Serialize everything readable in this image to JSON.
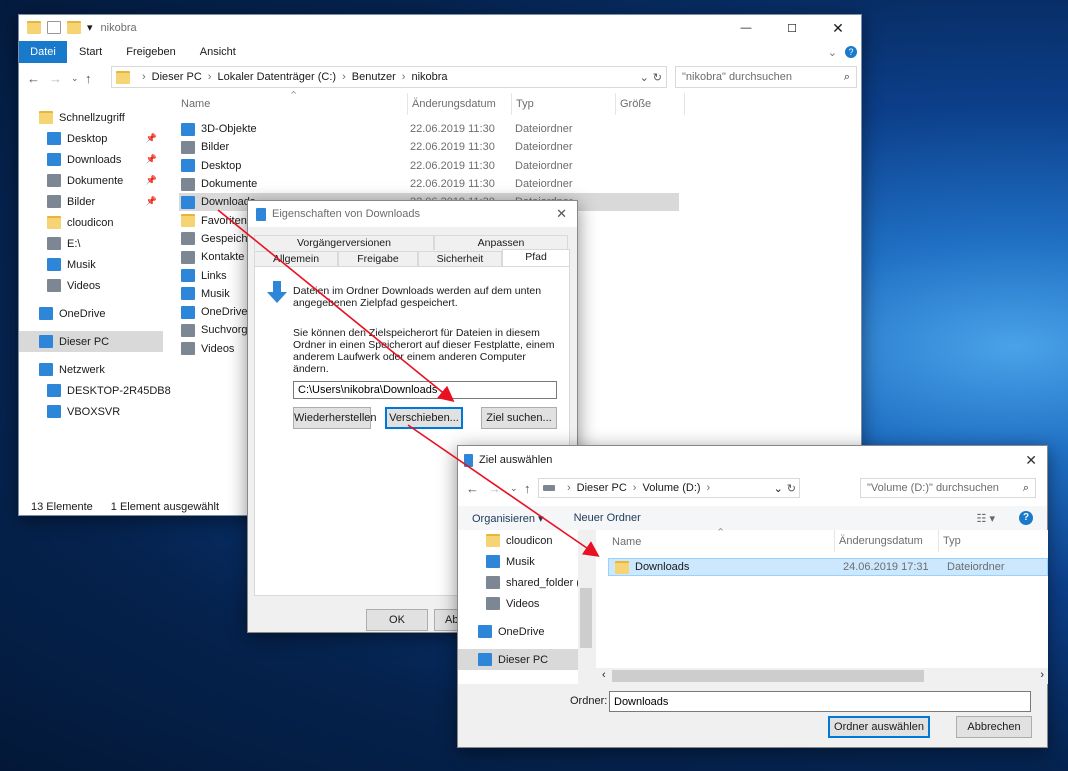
{
  "explorer": {
    "title": "nikobra",
    "ribbon_tabs": [
      "Datei",
      "Start",
      "Freigeben",
      "Ansicht"
    ],
    "breadcrumb": [
      "Dieser PC",
      "Lokaler Datenträger (C:)",
      "Benutzer",
      "nikobra"
    ],
    "search_placeholder": "\"nikobra\" durchsuchen",
    "columns": [
      "Name",
      "Änderungsdatum",
      "Typ",
      "Größe"
    ],
    "sidebar": [
      {
        "label": "Schnellzugriff",
        "icon": "star-icon",
        "indent": 0
      },
      {
        "label": "Desktop",
        "icon": "desktop-icon",
        "indent": 1,
        "pinned": true
      },
      {
        "label": "Downloads",
        "icon": "download-icon",
        "indent": 1,
        "pinned": true
      },
      {
        "label": "Dokumente",
        "icon": "document-icon",
        "indent": 1,
        "pinned": true
      },
      {
        "label": "Bilder",
        "icon": "pictures-icon",
        "indent": 1,
        "pinned": true
      },
      {
        "label": "cloudicon",
        "icon": "folder-icon",
        "indent": 1
      },
      {
        "label": "E:\\",
        "icon": "drive-icon",
        "indent": 1
      },
      {
        "label": "Musik",
        "icon": "music-icon",
        "indent": 1
      },
      {
        "label": "Videos",
        "icon": "video-icon",
        "indent": 1
      },
      {
        "label": "",
        "icon": "",
        "indent": 0
      },
      {
        "label": "OneDrive",
        "icon": "cloud-icon",
        "indent": 0
      },
      {
        "label": "",
        "icon": "",
        "indent": 0
      },
      {
        "label": "Dieser PC",
        "icon": "computer-icon",
        "indent": 0,
        "selected": true
      },
      {
        "label": "",
        "icon": "",
        "indent": 0
      },
      {
        "label": "Netzwerk",
        "icon": "network-icon",
        "indent": 0
      },
      {
        "label": "DESKTOP-2R45DB8",
        "icon": "computer-icon",
        "indent": 1
      },
      {
        "label": "VBOXSVR",
        "icon": "computer-icon",
        "indent": 1
      }
    ],
    "files": [
      {
        "name": "3D-Objekte",
        "date": "22.06.2019 11:30",
        "type": "Dateiordner",
        "icon": "cube-icon"
      },
      {
        "name": "Bilder",
        "date": "22.06.2019 11:30",
        "type": "Dateiordner",
        "icon": "pictures-icon"
      },
      {
        "name": "Desktop",
        "date": "22.06.2019 11:30",
        "type": "Dateiordner",
        "icon": "desktop-icon"
      },
      {
        "name": "Dokumente",
        "date": "22.06.2019 11:30",
        "type": "Dateiordner",
        "icon": "document-icon"
      },
      {
        "name": "Downloads",
        "date": "22.06.2019 11:30",
        "type": "Dateiordner",
        "icon": "download-icon",
        "selected": true
      },
      {
        "name": "Favoriten",
        "date": "",
        "type": "",
        "icon": "star-icon"
      },
      {
        "name": "Gespeicher",
        "date": "",
        "type": "",
        "icon": "search-icon"
      },
      {
        "name": "Kontakte",
        "date": "",
        "type": "",
        "icon": "contacts-icon"
      },
      {
        "name": "Links",
        "date": "",
        "type": "",
        "icon": "link-icon"
      },
      {
        "name": "Musik",
        "date": "",
        "type": "",
        "icon": "music-icon"
      },
      {
        "name": "OneDrive",
        "date": "",
        "type": "",
        "icon": "cloud-icon"
      },
      {
        "name": "Suchvorgä",
        "date": "",
        "type": "",
        "icon": "search-icon"
      },
      {
        "name": "Videos",
        "date": "",
        "type": "",
        "icon": "video-icon"
      }
    ],
    "status_count": "13 Elemente",
    "status_selected": "1 Element ausgewählt"
  },
  "properties": {
    "title": "Eigenschaften von Downloads",
    "tabs_top": [
      "Vorgängerversionen",
      "Anpassen"
    ],
    "tabs_bottom": [
      "Allgemein",
      "Freigabe",
      "Sicherheit",
      "Pfad"
    ],
    "info1": "Dateien im Ordner Downloads werden auf dem unten angegebenen Zielpfad gespeichert.",
    "info2": "Sie können den Zielspeicherort für Dateien in diesem Ordner in einen Speicherort auf dieser Festplatte, einem anderem Laufwerk oder einem anderen Computer ändern.",
    "path": "C:\\Users\\nikobra\\Downloads",
    "restore": "Wiederherstellen",
    "move": "Verschieben...",
    "find": "Ziel suchen...",
    "ok": "OK",
    "cancel_partial": "Ab"
  },
  "picker": {
    "title": "Ziel auswählen",
    "breadcrumb": [
      "Dieser PC",
      "Volume (D:)"
    ],
    "search_placeholder": "\"Volume (D:)\" durchsuchen",
    "organize": "Organisieren",
    "new_folder": "Neuer Ordner",
    "nav": [
      {
        "label": "cloudicon",
        "icon": "folder-icon"
      },
      {
        "label": "Musik",
        "icon": "music-icon"
      },
      {
        "label": "shared_folder (\\\\",
        "icon": "network-drive-icon"
      },
      {
        "label": "Videos",
        "icon": "video-icon"
      },
      {
        "label": "OneDrive",
        "icon": "cloud-icon"
      },
      {
        "label": "Dieser PC",
        "icon": "computer-icon"
      }
    ],
    "columns": [
      "Name",
      "Änderungsdatum",
      "Typ"
    ],
    "files": [
      {
        "name": "Downloads",
        "date": "24.06.2019 17:31",
        "type": "Dateiordner"
      }
    ],
    "folder_label": "Ordner:",
    "folder_value": "Downloads",
    "select": "Ordner auswählen",
    "cancel": "Abbrechen"
  },
  "colors": {
    "accent": "#0078d7",
    "selection": "#cce8ff",
    "arrow": "#e81123"
  }
}
